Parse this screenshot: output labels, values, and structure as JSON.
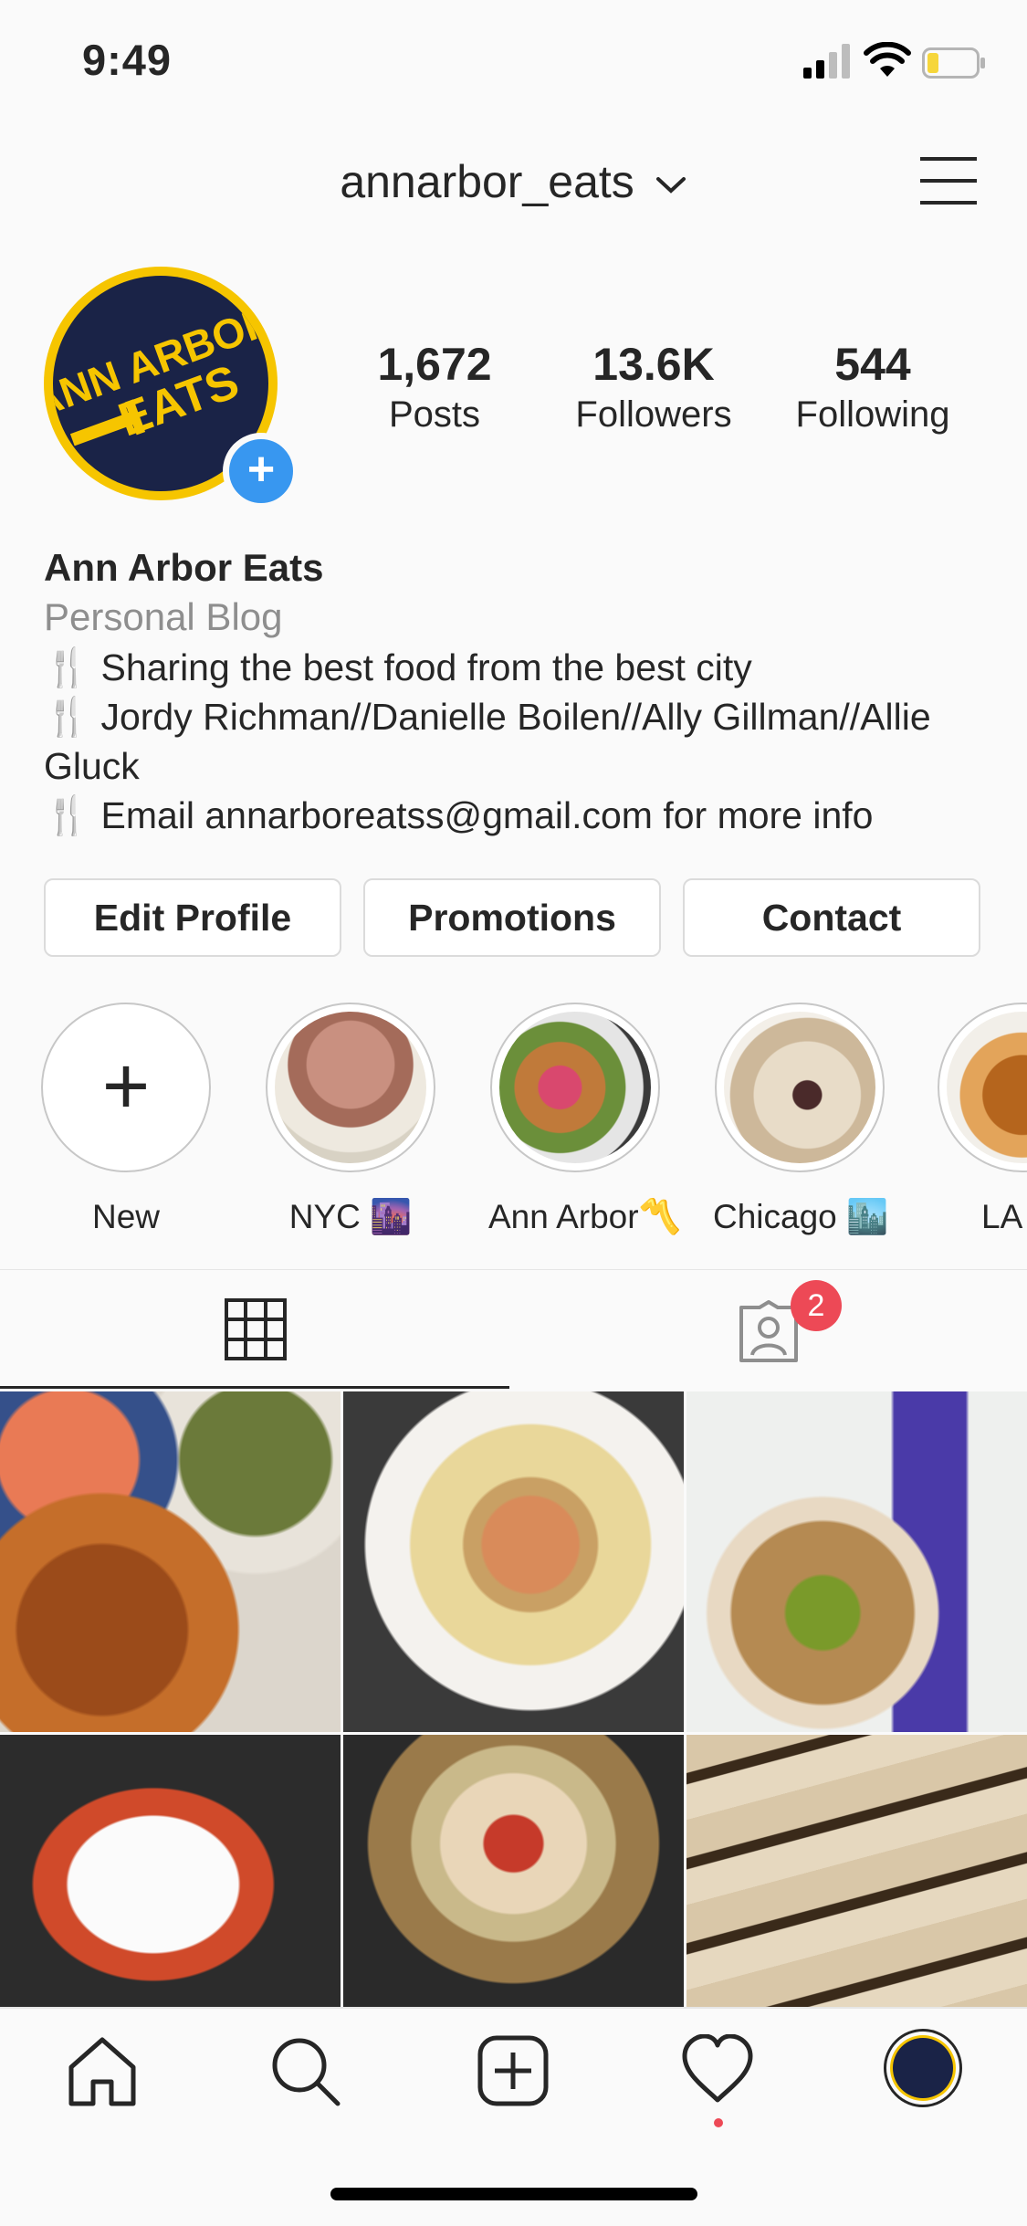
{
  "status_bar": {
    "time": "9:49"
  },
  "header": {
    "username": "annarbor_eats"
  },
  "profile": {
    "avatar_logo_text": "ANN ARBOR EATS",
    "stats": [
      {
        "value": "1,672",
        "label": "Posts"
      },
      {
        "value": "13.6K",
        "label": "Followers"
      },
      {
        "value": "544",
        "label": "Following"
      }
    ],
    "name": "Ann Arbor Eats",
    "category": "Personal Blog",
    "bio_lines": [
      "Sharing the best food from the best city",
      "Jordy Richman//Danielle Boilen//Ally Gillman//Allie Gluck",
      "Email annarboreatss@gmail.com for more info"
    ]
  },
  "buttons": {
    "edit": "Edit Profile",
    "promotions": "Promotions",
    "contact": "Contact"
  },
  "highlights": [
    {
      "label": "New"
    },
    {
      "label": "NYC 🌆"
    },
    {
      "label": "Ann Arbor〽️"
    },
    {
      "label": "Chicago 🏙️"
    },
    {
      "label": "LA"
    }
  ],
  "tabs": {
    "tagged_badge": "2"
  },
  "colors": {
    "accent_blue": "#3897f0",
    "badge_red": "#ed4956",
    "logo_yellow": "#f6c500",
    "logo_navy": "#1a2347"
  }
}
